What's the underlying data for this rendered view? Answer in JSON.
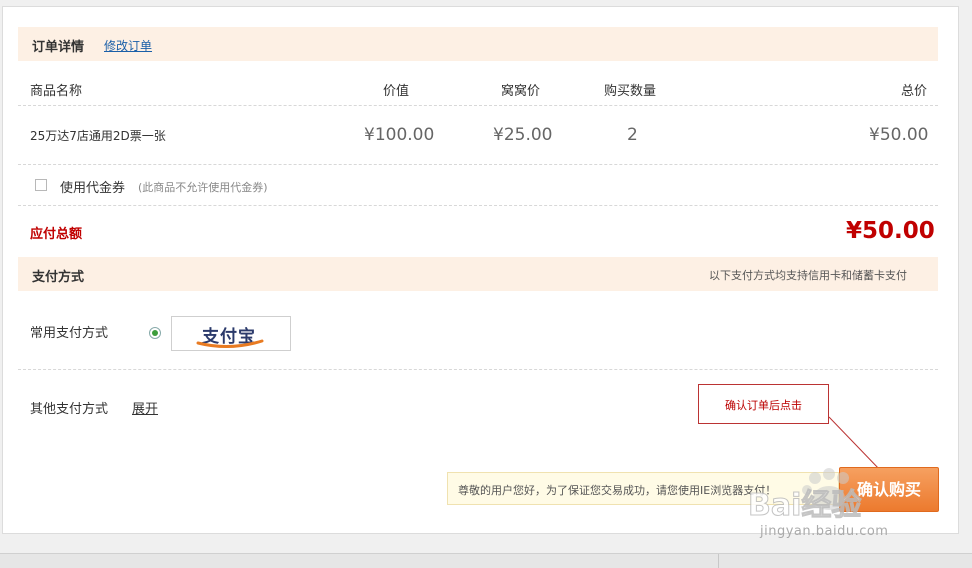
{
  "order_section": {
    "title": "订单详情",
    "modify_link": "修改订单"
  },
  "table": {
    "headers": {
      "name": "商品名称",
      "value": "价值",
      "price": "窝窝价",
      "quantity": "购买数量",
      "total": "总价"
    },
    "rows": [
      {
        "name": "25万达7店通用2D票一张",
        "value": "¥100.00",
        "price": "¥25.00",
        "quantity": "2",
        "total": "¥50.00"
      }
    ]
  },
  "voucher": {
    "label": "使用代金券",
    "note": "(此商品不允许使用代金券)",
    "checked": false
  },
  "total": {
    "label": "应付总额",
    "amount": "¥50.00"
  },
  "payment_section": {
    "title": "支付方式",
    "note": "以下支付方式均支持信用卡和储蓄卡支付",
    "common_label": "常用支付方式",
    "alipay_text": "支付宝",
    "other_label": "其他支付方式",
    "expand_link": "展开"
  },
  "callout": {
    "text": "确认订单后点击"
  },
  "notice": {
    "text": "尊敬的用户您好，为了保证您交易成功，请您使用IE浏览器支付！"
  },
  "confirm_button": {
    "label": "确认购买"
  },
  "watermark": {
    "logo_text": "Bai经验",
    "url": "jingyan.baidu.com"
  },
  "colors": {
    "accent_red": "#c00000",
    "section_bg": "#fdf0e4",
    "button_orange": "#ec7a2e",
    "link_blue": "#1a5fa8"
  }
}
